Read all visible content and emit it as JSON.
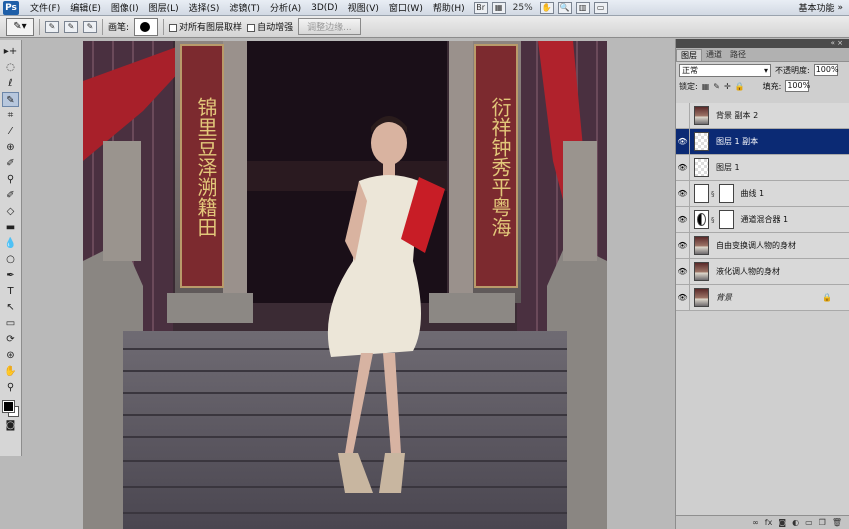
{
  "app": {
    "logo": "Ps"
  },
  "menu": {
    "items": [
      "文件(F)",
      "编辑(E)",
      "图像(I)",
      "图层(L)",
      "选择(S)",
      "滤镜(T)",
      "分析(A)",
      "3D(D)",
      "视图(V)",
      "窗口(W)",
      "帮助(H)"
    ],
    "zoom": "25%",
    "workspace": "基本功能"
  },
  "options": {
    "brush_label": "画笔:",
    "sample_all_layers": "对所有图层取样",
    "auto_enhance": "自动增强",
    "refine_edge": "调整边缘..."
  },
  "colors": {
    "foreground": "#000000",
    "background": "#ffffff",
    "selection": "#0b2a74"
  },
  "panel": {
    "tabs": [
      "图层",
      "通道",
      "路径"
    ],
    "blend_mode": "正常",
    "opacity_label": "不透明度:",
    "opacity": "100%",
    "lock_label": "锁定:",
    "fill_label": "填充:",
    "fill": "100%"
  },
  "layers": [
    {
      "name": "背景 副本 2",
      "visible": false,
      "thumb": "photo",
      "selected": false
    },
    {
      "name": "图层 1 副本",
      "visible": true,
      "thumb": "checker",
      "selected": true
    },
    {
      "name": "图层 1",
      "visible": true,
      "thumb": "checker",
      "selected": false
    },
    {
      "name": "曲线 1",
      "visible": true,
      "thumb": "curves",
      "selected": false
    },
    {
      "name": "通道混合器 1",
      "visible": true,
      "thumb": "mixer",
      "selected": false
    },
    {
      "name": "自由变换调人物的身材",
      "visible": true,
      "thumb": "photo",
      "selected": false
    },
    {
      "name": "液化调人物的身材",
      "visible": true,
      "thumb": "photo",
      "selected": false
    },
    {
      "name": "背景",
      "visible": true,
      "thumb": "photo",
      "selected": false,
      "locked": true
    }
  ],
  "photo": {
    "left_couplet": "锦里豆泽溯籍田",
    "right_couplet": "衍祥钟秀平粤海"
  }
}
